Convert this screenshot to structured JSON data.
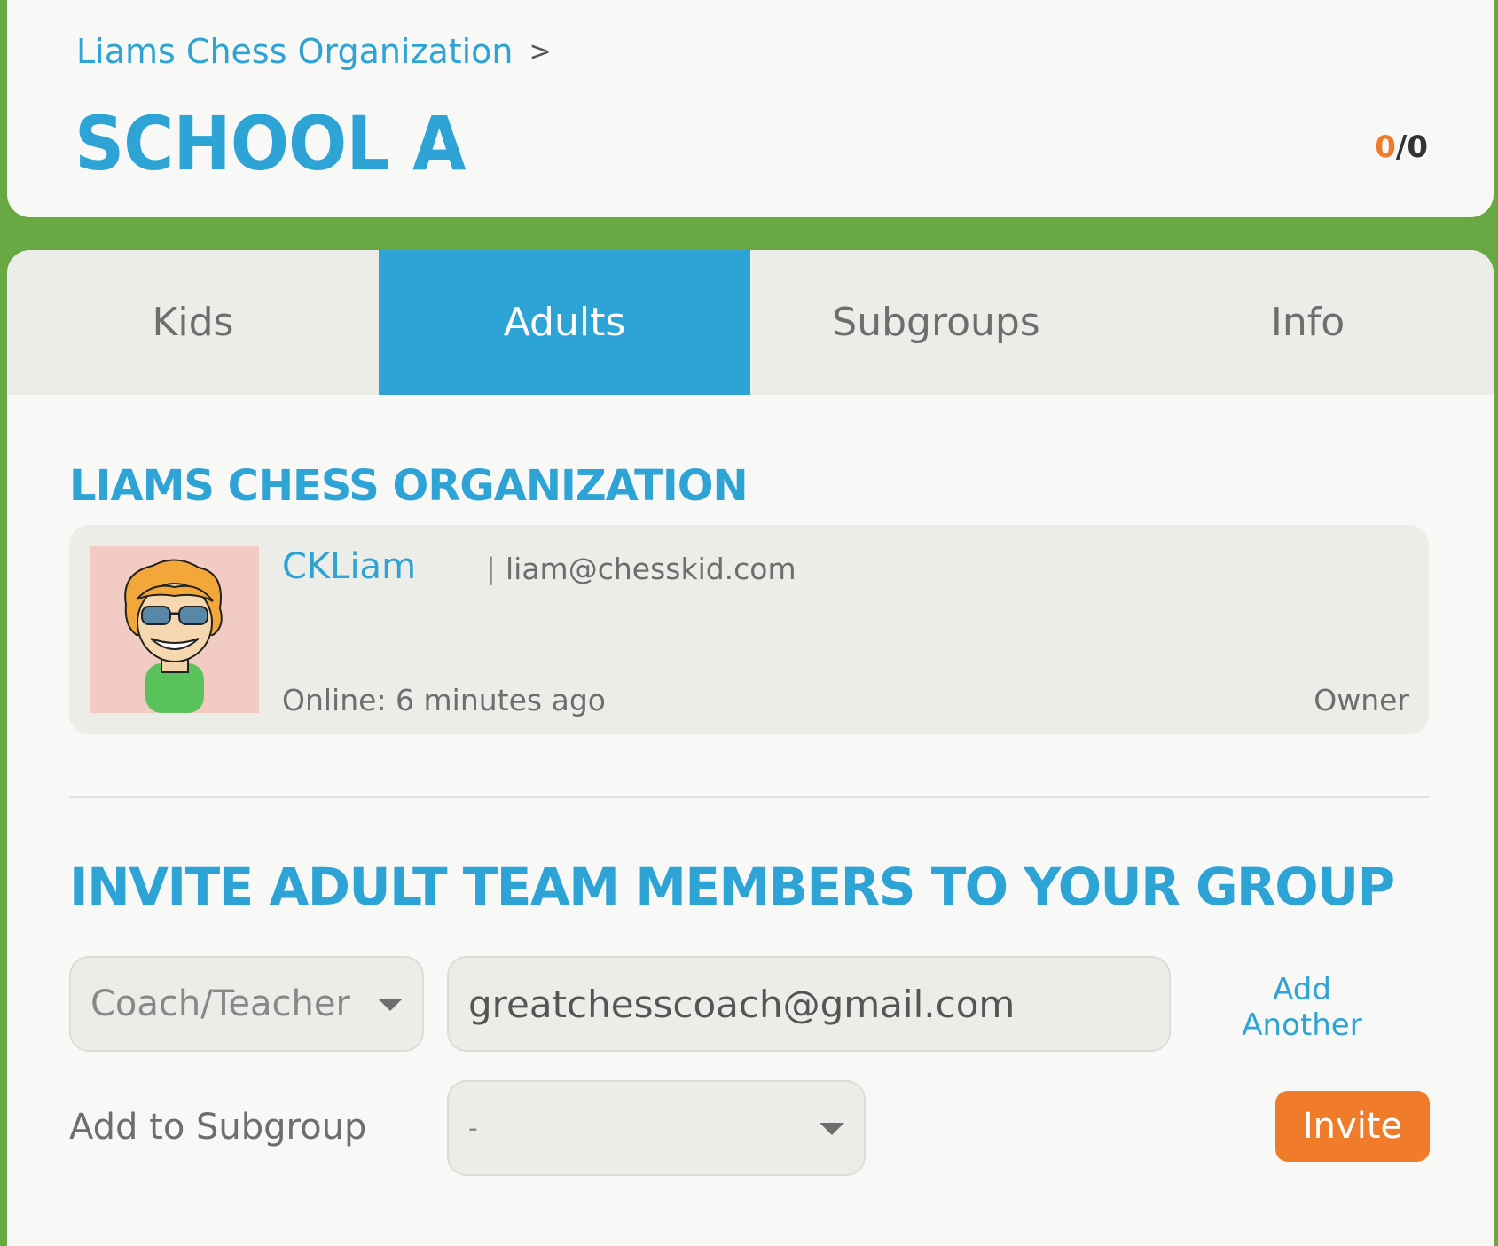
{
  "header": {
    "breadcrumb": {
      "parent": "Liams Chess Organization",
      "separator": ">"
    },
    "title": "School A",
    "counter": {
      "current": "0",
      "separator": "/",
      "total": "0"
    }
  },
  "tabs": [
    {
      "label": "Kids",
      "active": false
    },
    {
      "label": "Adults",
      "active": true
    },
    {
      "label": "Subgroups",
      "active": false
    },
    {
      "label": "Info",
      "active": false
    }
  ],
  "organization": {
    "title": "Liams Chess Organization",
    "member": {
      "name": "CKLiam",
      "separator": "|",
      "email": "liam@chesskid.com",
      "online": "Online: 6 minutes ago",
      "role": "Owner"
    }
  },
  "invite": {
    "title": "Invite Adult Team Members To Your Group",
    "role_value": "Coach/Teacher",
    "email_value": "greatchesscoach@gmail.com",
    "add_another_line1": "Add",
    "add_another_line2": "Another",
    "subgroup_label": "Add to Subgroup",
    "subgroup_value": "-",
    "invite_button": "Invite"
  },
  "colors": {
    "accent": "#2ea3d5",
    "button": "#f07b2a",
    "background": "#6aa843"
  }
}
